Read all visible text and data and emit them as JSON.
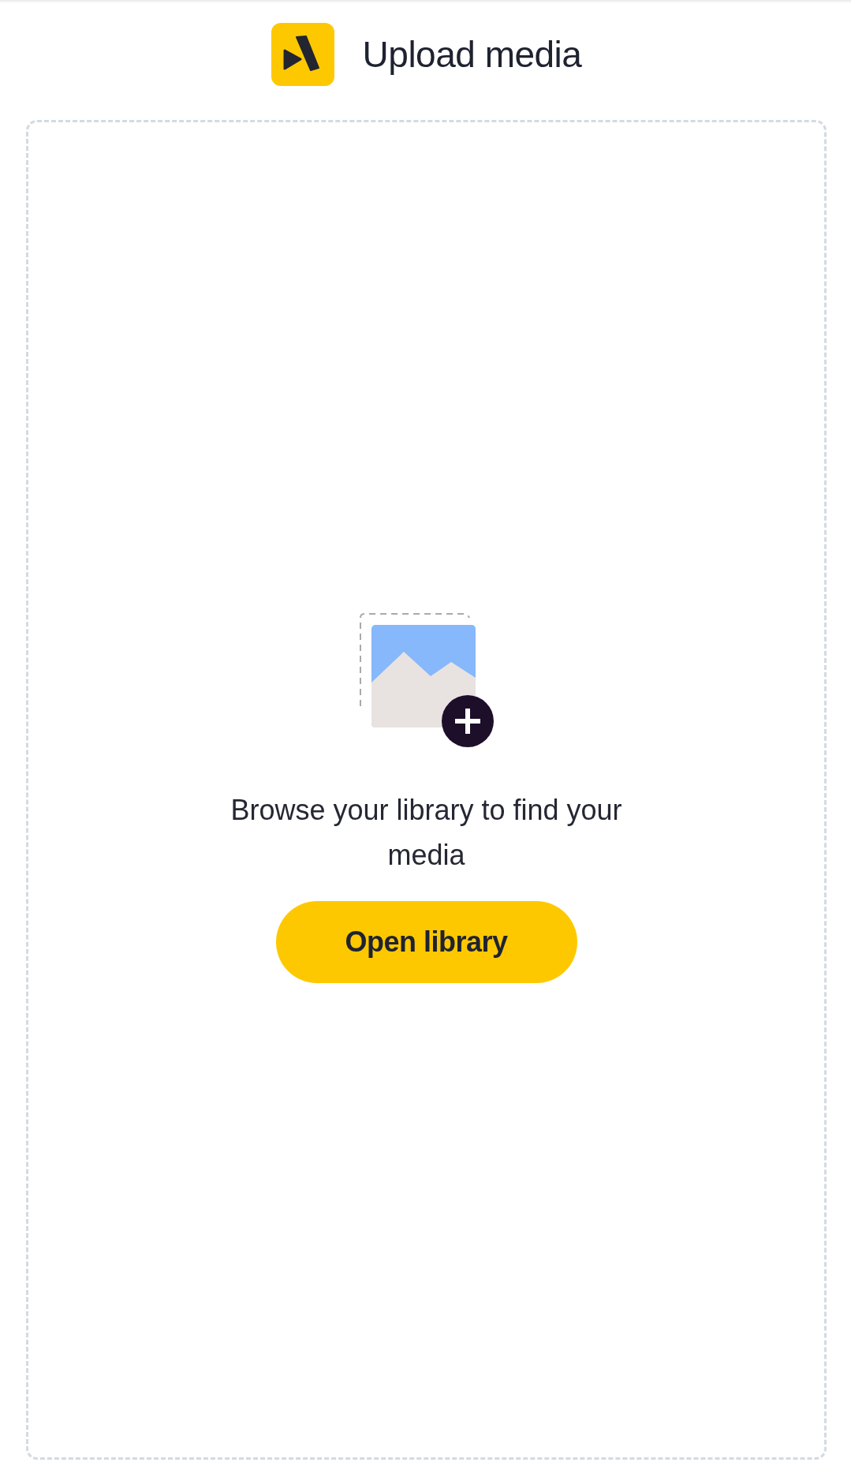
{
  "header": {
    "title": "Upload media"
  },
  "dropzone": {
    "message": "Browse your library to find your media",
    "button": "Open library"
  }
}
